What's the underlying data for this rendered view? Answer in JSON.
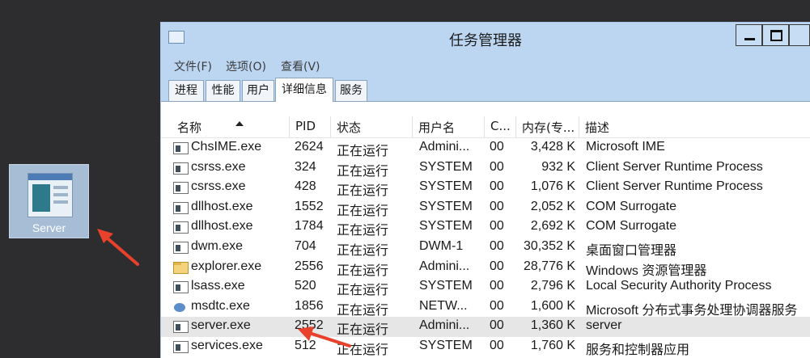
{
  "desktop": {
    "icon_label": "Server"
  },
  "window": {
    "title": "任务管理器",
    "menu": [
      "文件(F)",
      "选项(O)",
      "查看(V)"
    ],
    "tabs": [
      "进程",
      "性能",
      "用户",
      "详细信息",
      "服务"
    ],
    "active_tab": "详细信息",
    "columns": [
      "名称",
      "PID",
      "状态",
      "用户名",
      "C...",
      "内存(专...",
      "描述"
    ],
    "rows": [
      {
        "icon": "app-window-icon",
        "name": "ChsIME.exe",
        "pid": "2624",
        "status": "正在运行",
        "user": "Admini...",
        "cpu": "00",
        "mem": "3,428 K",
        "desc": "Microsoft IME"
      },
      {
        "icon": "app-window-icon",
        "name": "csrss.exe",
        "pid": "324",
        "status": "正在运行",
        "user": "SYSTEM",
        "cpu": "00",
        "mem": "932 K",
        "desc": "Client Server Runtime Process"
      },
      {
        "icon": "app-window-icon",
        "name": "csrss.exe",
        "pid": "428",
        "status": "正在运行",
        "user": "SYSTEM",
        "cpu": "00",
        "mem": "1,076 K",
        "desc": "Client Server Runtime Process"
      },
      {
        "icon": "app-window-icon",
        "name": "dllhost.exe",
        "pid": "1552",
        "status": "正在运行",
        "user": "SYSTEM",
        "cpu": "00",
        "mem": "2,052 K",
        "desc": "COM Surrogate"
      },
      {
        "icon": "app-window-icon",
        "name": "dllhost.exe",
        "pid": "1784",
        "status": "正在运行",
        "user": "SYSTEM",
        "cpu": "00",
        "mem": "2,692 K",
        "desc": "COM Surrogate"
      },
      {
        "icon": "app-window-icon",
        "name": "dwm.exe",
        "pid": "704",
        "status": "正在运行",
        "user": "DWM-1",
        "cpu": "00",
        "mem": "30,352 K",
        "desc": "桌面窗口管理器"
      },
      {
        "icon": "folder-icon",
        "name": "explorer.exe",
        "pid": "2556",
        "status": "正在运行",
        "user": "Admini...",
        "cpu": "00",
        "mem": "28,776 K",
        "desc": "Windows 资源管理器"
      },
      {
        "icon": "app-window-icon",
        "name": "lsass.exe",
        "pid": "520",
        "status": "正在运行",
        "user": "SYSTEM",
        "cpu": "00",
        "mem": "2,796 K",
        "desc": "Local Security Authority Process"
      },
      {
        "icon": "gear-icon",
        "name": "msdtc.exe",
        "pid": "1856",
        "status": "正在运行",
        "user": "NETW...",
        "cpu": "00",
        "mem": "1,600 K",
        "desc": "Microsoft 分布式事务处理协调器服务"
      },
      {
        "icon": "app-window-icon",
        "name": "server.exe",
        "pid": "2552",
        "status": "正在运行",
        "user": "Admini...",
        "cpu": "00",
        "mem": "1,360 K",
        "desc": "server"
      },
      {
        "icon": "app-window-icon",
        "name": "services.exe",
        "pid": "512",
        "status": "正在运行",
        "user": "SYSTEM",
        "cpu": "00",
        "mem": "1,760 K",
        "desc": "服务和控制器应用"
      }
    ],
    "selected_row_name": "server.exe"
  },
  "colors": {
    "desktop_bg": "#2d2d2f",
    "chrome": "#bcd6f2",
    "annotation_arrow": "#e8412c"
  }
}
